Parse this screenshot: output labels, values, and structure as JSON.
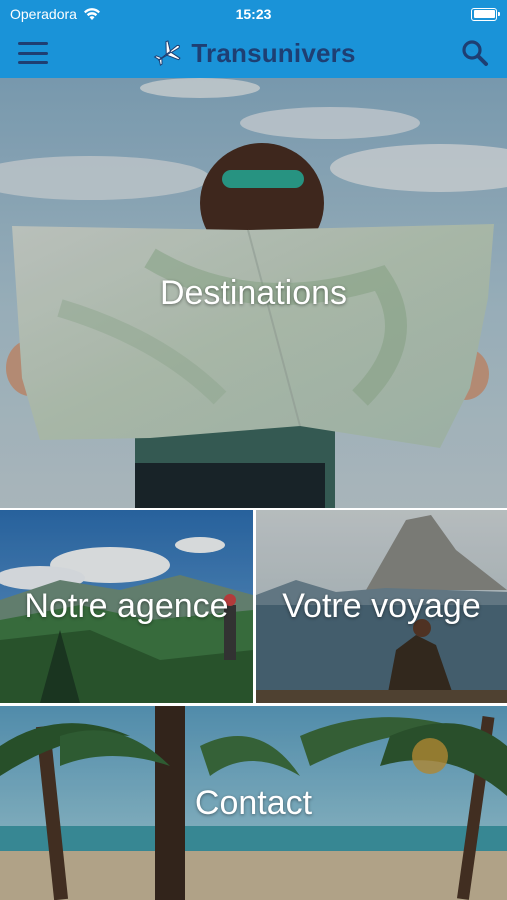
{
  "status_bar": {
    "carrier": "Operadora",
    "time": "15:23"
  },
  "nav": {
    "brand": "Transunivers"
  },
  "tiles": {
    "destinations": "Destinations",
    "agence": "Notre agence",
    "voyage": "Votre voyage",
    "contact": "Contact"
  },
  "colors": {
    "header_bg": "#1a93d8",
    "brand_text": "#1e3f73"
  }
}
